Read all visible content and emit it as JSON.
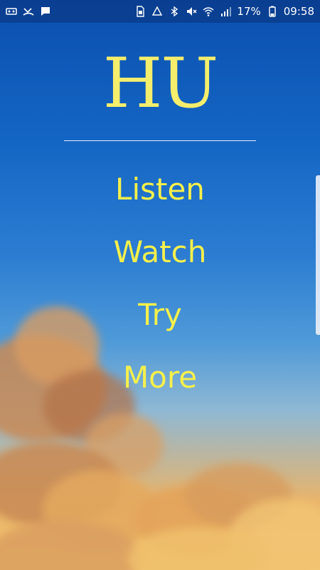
{
  "status_bar": {
    "battery_percent": "17%",
    "time": "09:58",
    "left_icons": [
      "voicemail-icon",
      "missed-call-icon",
      "message-icon"
    ],
    "right_icons": [
      "sim-icon",
      "data-saver-icon",
      "bluetooth-icon",
      "mute-icon",
      "wifi-icon",
      "signal-icon",
      "battery-icon"
    ]
  },
  "app": {
    "title": "HU"
  },
  "menu": {
    "items": [
      {
        "label": "Listen"
      },
      {
        "label": "Watch"
      },
      {
        "label": "Try"
      },
      {
        "label": "More"
      }
    ]
  },
  "colors": {
    "title": "#f4ee6c",
    "menu_text": "#f7f04b",
    "sky_top": "#0b4fb0",
    "cloud": "#e9a55a"
  }
}
